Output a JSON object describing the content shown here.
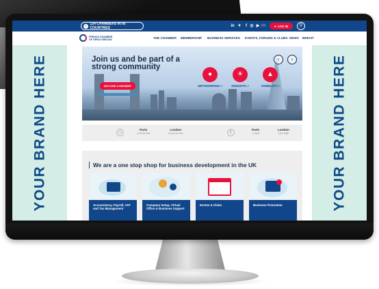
{
  "topbar": {
    "chamber_count": "124 CHAMBERS IN 95 COUNTRIES",
    "language": "FR",
    "login_label": "LOG IN"
  },
  "logo": {
    "line1": "FRENCH CHAMBER",
    "line2": "OF GREAT BRITAIN"
  },
  "nav": {
    "items": [
      "THE CHAMBER",
      "MEMBERSHIP",
      "BUSINESS SERVICES",
      "EVENTS, FORUMS & CLUBS",
      "NEWS",
      "BREXIT"
    ]
  },
  "side_banner": {
    "left_text": "YOUR BRAND HERE",
    "right_text": "YOUR BRAND HERE"
  },
  "hero": {
    "title": "Join us and be part of a strong community",
    "cta_label": "BECOME A MEMBER",
    "features": [
      "NETWORKING »",
      "INSIGHTS »",
      "VISIBILITY »"
    ]
  },
  "info": {
    "times": [
      {
        "city": "Paris",
        "value": "1:23:30 PM"
      },
      {
        "city": "London",
        "value": "12:23:30 PM"
      }
    ],
    "currency": [
      {
        "city": "Paris",
        "value": "1 EUR"
      },
      {
        "city": "London",
        "value": "0.83 GBP"
      }
    ]
  },
  "services": {
    "title": "We are a one stop shop for business development in the UK",
    "cards": [
      "Accountancy, Payroll, VAT and Tax Management",
      "Company Setup, Virtual Office & Business Support",
      "Events & Clubs",
      "Business Promotion"
    ]
  },
  "colors": {
    "brand_blue": "#12468a",
    "accent_red": "#e8113c",
    "banner_mint": "#d4ede6"
  },
  "icons": {
    "networking": "network-icon",
    "insights": "lightbulb-icon",
    "visibility": "megaphone-icon",
    "clock": "clock-icon",
    "euro": "euro-icon"
  }
}
